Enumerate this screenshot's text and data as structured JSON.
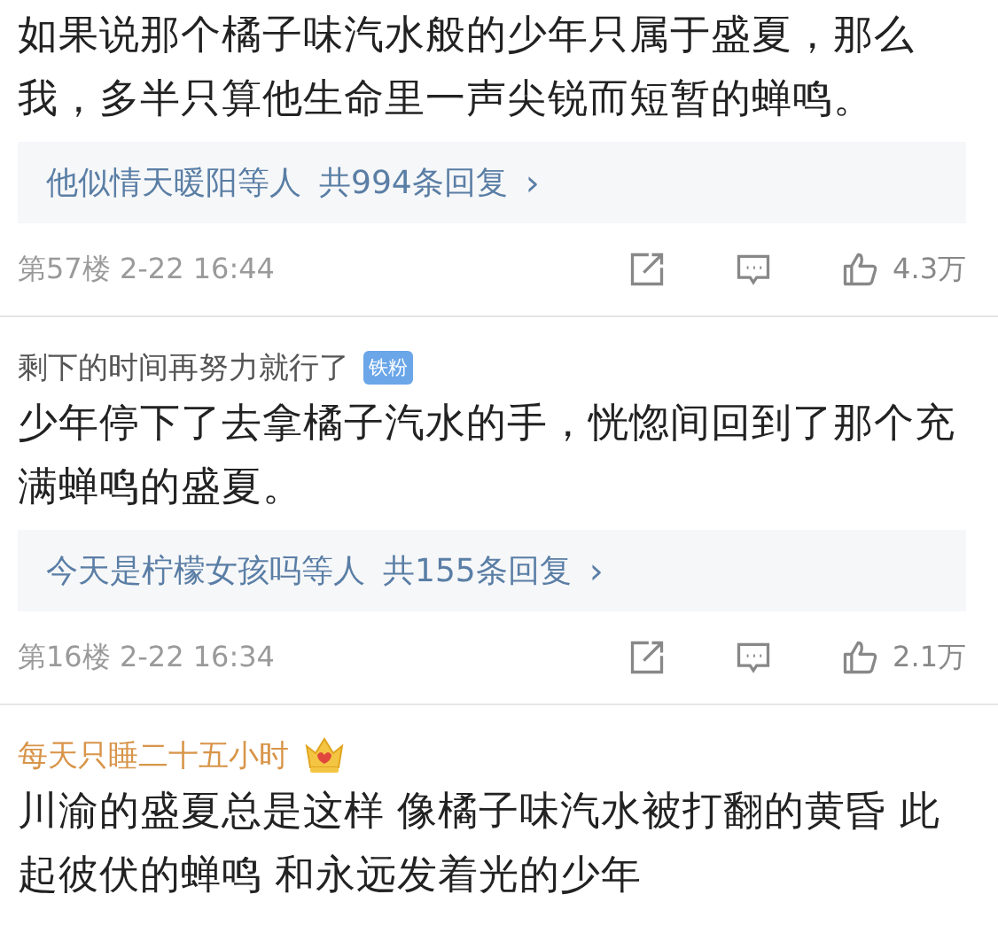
{
  "comments": [
    {
      "body": "如果说那个橘子味汽水般的少年只属于盛夏，那么我，多半只算他生命里一声尖锐而短暂的蝉鸣。",
      "replies": {
        "names": "他似情天暖阳等人",
        "count": "共994条回复",
        "arrow": "›"
      },
      "floor": "第57楼",
      "time": "2-22 16:44",
      "likes": "4.3万"
    },
    {
      "user": "剩下的时间再努力就行了",
      "vip": false,
      "badge": {
        "kind": "fan",
        "label": "铁粉"
      },
      "body": "少年停下了去拿橘子汽水的手，恍惚间回到了那个充满蝉鸣的盛夏。",
      "replies": {
        "names": "今天是柠檬女孩吗等人",
        "count": "共155条回复",
        "arrow": "›"
      },
      "floor": "第16楼",
      "time": "2-22 16:34",
      "likes": "2.1万"
    },
    {
      "user": "每天只睡二十五小时",
      "vip": true,
      "badge": {
        "kind": "crown"
      },
      "body": "川渝的盛夏总是这样 像橘子味汽水被打翻的黄昏 此起彼伏的蝉鸣 和永远发着光的少年"
    }
  ]
}
